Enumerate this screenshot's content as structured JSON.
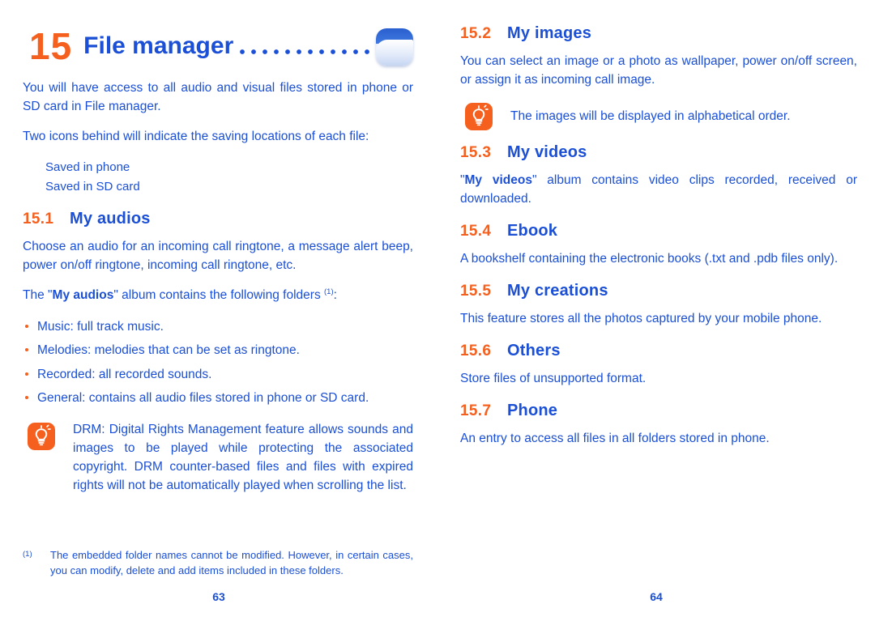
{
  "colors": {
    "accent_orange": "#f5601e",
    "text_blue": "#1a4fd6"
  },
  "left_page": {
    "chapter": {
      "number": "15",
      "title": "File manager",
      "icon": "folder-icon"
    },
    "intro": "You will have access to all audio and visual files stored in phone or SD card in File manager.",
    "locations_intro": "Two icons behind will indicate the saving locations of each file:",
    "locations": [
      "Saved in phone",
      "Saved in SD card"
    ],
    "section_15_1": {
      "number": "15.1",
      "title": "My audios",
      "paragraph": "Choose an audio for an incoming call ringtone, a message alert beep, power on/off ringtone, incoming call ringtone, etc.",
      "folders_intro_pre": "The \"",
      "folders_intro_bold": "My audios",
      "folders_intro_post": "\" album contains the following folders ",
      "folders_intro_marker": "(1)",
      "folders_intro_end": ":",
      "bullets": [
        "Music: full track music.",
        "Melodies: melodies that can be set as ringtone.",
        "Recorded: all recorded sounds.",
        "General: contains all audio files stored in phone or SD card."
      ]
    },
    "drm_note": {
      "icon": "lightbulb-tip-icon",
      "text": "DRM: Digital Rights Management feature allows sounds and images to be played while protecting the associated copyright. DRM counter-based files and files with expired rights will not be automatically played when scrolling the list."
    },
    "footnote": {
      "marker": "(1)",
      "text": "The embedded folder names cannot be modified. However, in certain cases, you can modify, delete and add items included in these folders."
    },
    "folio": "63"
  },
  "right_page": {
    "section_15_2": {
      "number": "15.2",
      "title": "My images",
      "paragraph": "You can select an image or a photo as wallpaper, power on/off screen, or assign it as incoming call image.",
      "note": {
        "icon": "lightbulb-tip-icon",
        "text": "The images will be displayed in alphabetical order."
      }
    },
    "section_15_3": {
      "number": "15.3",
      "title": "My videos",
      "paragraph_pre": "\"",
      "paragraph_bold": "My videos",
      "paragraph_post": "\" album contains video clips recorded, received or downloaded."
    },
    "section_15_4": {
      "number": "15.4",
      "title": "Ebook",
      "paragraph": "A bookshelf containing the electronic books (.txt and .pdb files only)."
    },
    "section_15_5": {
      "number": "15.5",
      "title": "My creations",
      "paragraph": "This feature stores all the photos captured by your mobile phone."
    },
    "section_15_6": {
      "number": "15.6",
      "title": "Others",
      "paragraph": "Store files of unsupported format."
    },
    "section_15_7": {
      "number": "15.7",
      "title": "Phone",
      "paragraph": "An entry to access all files in all folders stored in phone."
    },
    "folio": "64"
  }
}
